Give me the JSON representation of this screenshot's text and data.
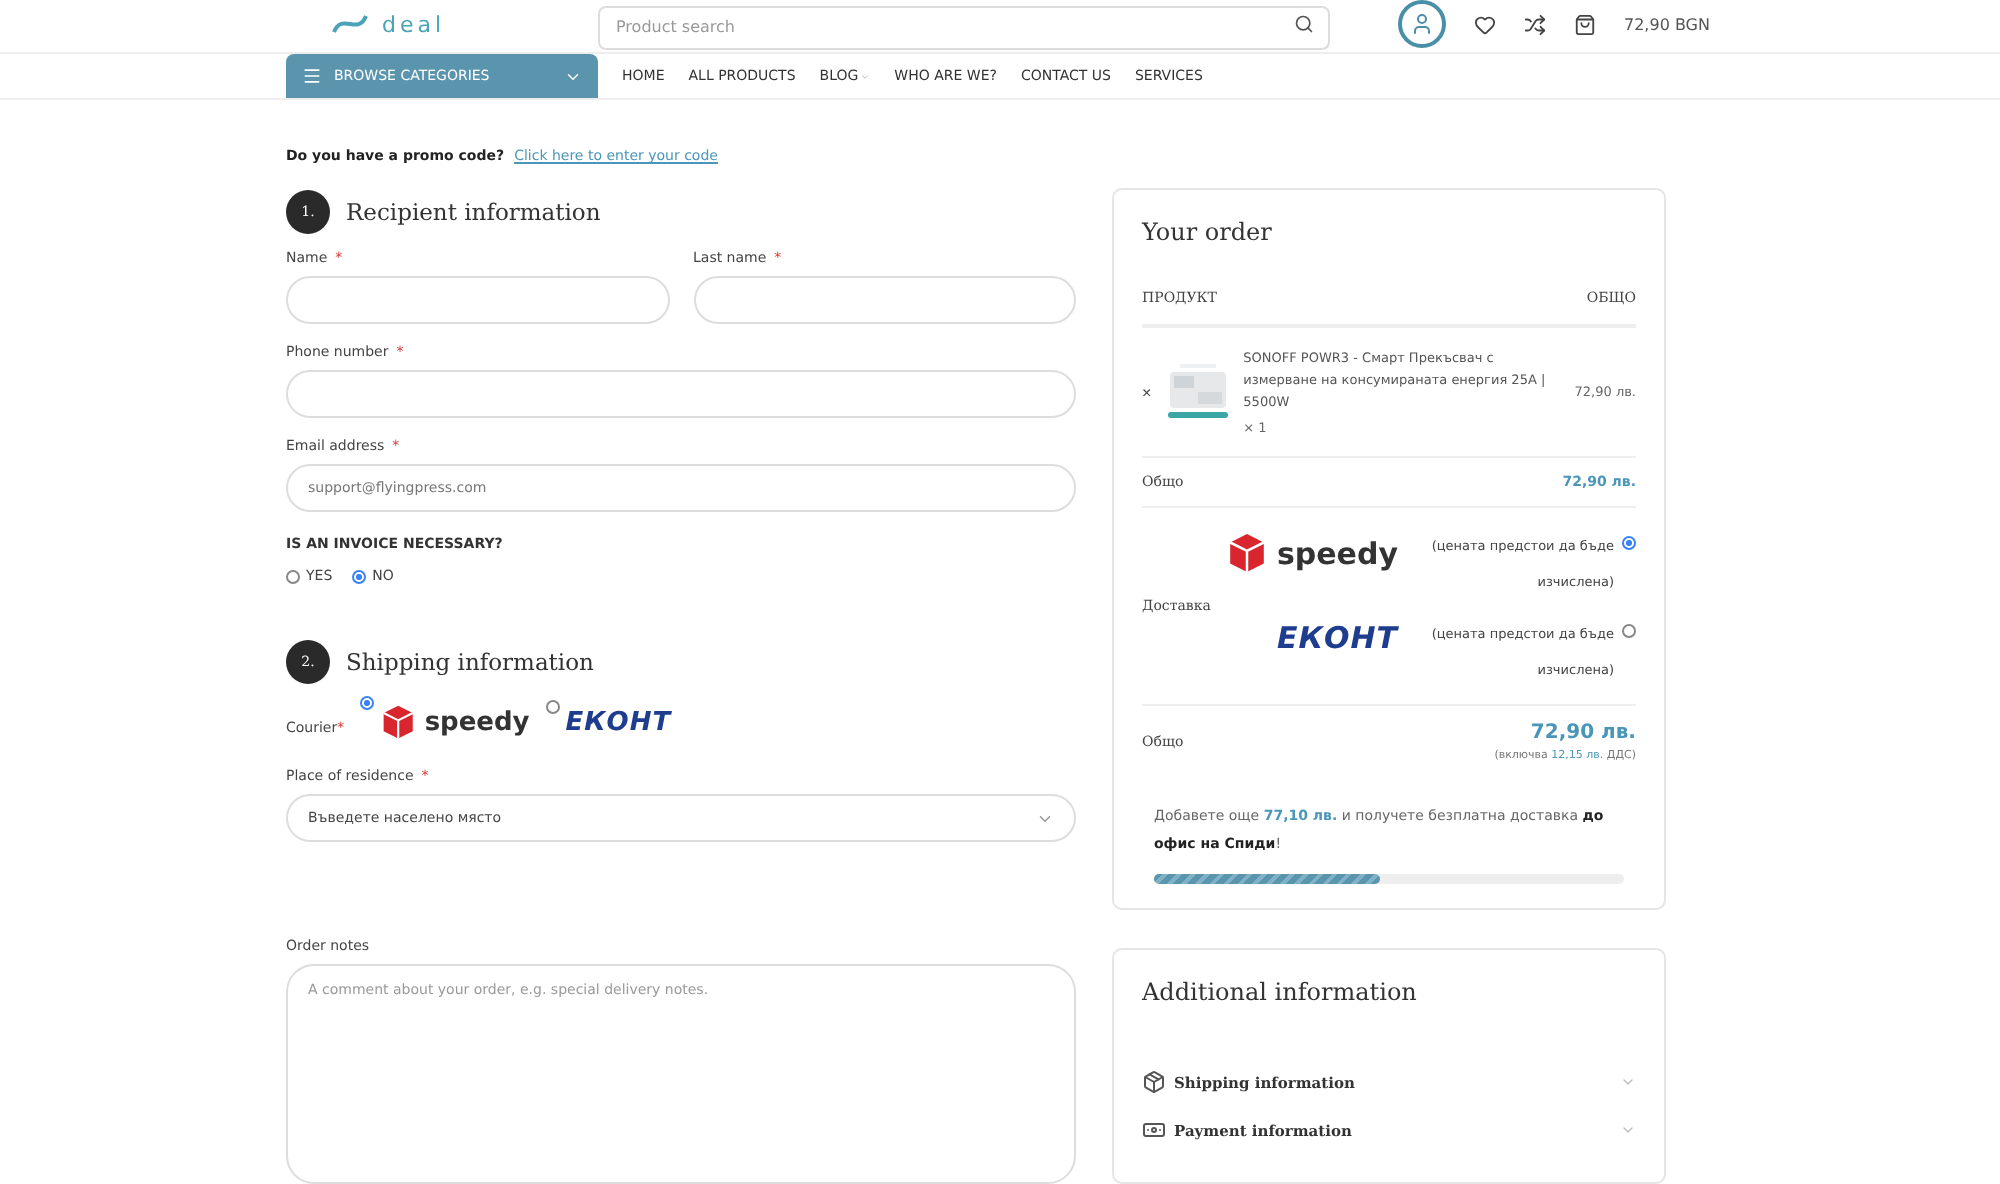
{
  "header": {
    "logo_text": "deal",
    "search": {
      "placeholder": "Product search"
    },
    "cart_total": "72,90 BGN"
  },
  "nav": {
    "browse": "BROWSE CATEGORIES",
    "links": [
      {
        "label": "HOME",
        "dropdown": false
      },
      {
        "label": "ALL PRODUCTS",
        "dropdown": false
      },
      {
        "label": "BLOG",
        "dropdown": true
      },
      {
        "label": "WHO ARE WE?",
        "dropdown": false
      },
      {
        "label": "CONTACT US",
        "dropdown": false
      },
      {
        "label": "SERVICES",
        "dropdown": false
      }
    ]
  },
  "promo": {
    "question": "Do you have a promo code?",
    "link": "Click here to enter your code"
  },
  "recipient": {
    "number": "1.",
    "title": "Recipient information",
    "rows": [
      {
        "fields": [
          {
            "label": "Name",
            "required_mark": "*"
          },
          {
            "label": "Last name",
            "required_mark": "*"
          }
        ]
      },
      {
        "fields": [
          {
            "label": "Phone number",
            "required_mark": "*"
          }
        ]
      },
      {
        "fields": [
          {
            "label": "Email address",
            "required_mark": "*",
            "placeholder": "support@flyingpress.com"
          }
        ]
      }
    ]
  },
  "invoice": {
    "question": "IS AN INVOICE NECESSARY?",
    "options": [
      {
        "label": "YES",
        "selected": false
      },
      {
        "label": "NO",
        "selected": true
      }
    ]
  },
  "shipping": {
    "number": "2.",
    "title": "Shipping information",
    "courier_label": "Courier",
    "courier_required_mark": "*",
    "couriers": [
      {
        "kind": "speedy",
        "name": "speedy",
        "selected": true
      },
      {
        "kind": "econt",
        "name": "ЕКОНТ",
        "selected": false
      }
    ],
    "place": {
      "label": "Place of residence",
      "required_mark": "*",
      "placeholder": "Въведете населено място"
    },
    "notes": {
      "label": "Order notes",
      "placeholder": "A comment about your order, e.g. special delivery notes."
    }
  },
  "order": {
    "title": "Your order",
    "columns": [
      "ПРОДУКТ",
      "ОБЩО"
    ],
    "item": {
      "remove": "×",
      "name": "SONOFF POWR3 - Смарт Прекъсвач с измерване на консумираната енергия 25A | 5500W",
      "quantity": "× 1",
      "price": "72,90 лв."
    },
    "subtotal": {
      "label": "Общо",
      "value": "72,90 лв."
    },
    "delivery": {
      "label": "Доставка",
      "options": [
        {
          "kind": "speedy",
          "name": "speedy",
          "note": "(цената предстои да бъде изчислена)",
          "selected": true
        },
        {
          "kind": "econt",
          "name": "ЕКОНТ",
          "note": "(цената предстои да бъде изчислена)",
          "selected": false
        }
      ]
    },
    "total": {
      "label": "Общо",
      "value": "72,90 лв.",
      "tax_prefix": "(включва",
      "tax": "12,15 лв.",
      "tax_suffix": "ДДС)"
    },
    "free_shipping": {
      "before": "Добавете още",
      "amount": "77,10 лв.",
      "after": "и получете безплатна доставка **до офис на Спиди**!",
      "level": 0.48
    }
  },
  "additional": {
    "title": "Additional information",
    "items": [
      {
        "kind": "shipping",
        "label": "Shipping information",
        "expanded": false
      },
      {
        "kind": "payment",
        "label": "Payment information",
        "expanded": false
      }
    ]
  }
}
